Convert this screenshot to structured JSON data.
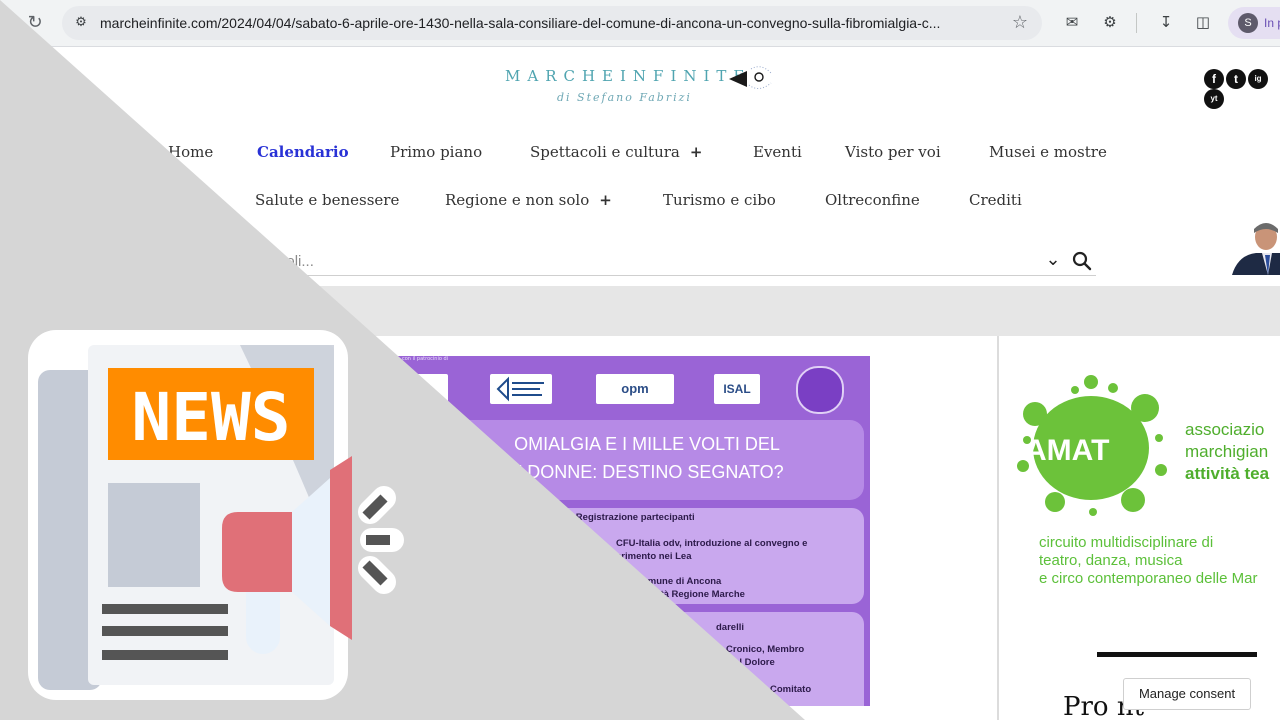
{
  "browser": {
    "url": "marcheinfinite.com/2024/04/04/sabato-6-aprile-ore-1430-nella-sala-consiliare-del-comune-di-ancona-un-convegno-sulla-fibromialgia-c...",
    "profile_initial": "S",
    "profile_text": "In p"
  },
  "site": {
    "logo_main": "MARCHEINFINITE",
    "logo_sub": "di Stefano Fabrizi",
    "social": [
      "f",
      "t",
      "ig",
      "yt"
    ],
    "nav_row1": [
      "Home",
      "Calendario",
      "Primo piano",
      "Spettacoli e cultura",
      "Eventi",
      "Visto per voi",
      "Musei e mostre"
    ],
    "nav_row2": [
      "Salute e benessere",
      "Regione e non solo",
      "Turismo e cibo",
      "Oltreconfine",
      "Crediti"
    ],
    "nav_plus": "+",
    "search_placeholder": "ca articoli..."
  },
  "poster": {
    "top_text": "con il patrocinio di",
    "sponsors": [
      "opm",
      "ISAL"
    ],
    "title_line1": "OMIALGIA E I MILLE VOLTI DEL",
    "title_line2": "E DONNE: DESTINO SEGNATO?",
    "lines": [
      "- Registrazione partecipanti",
      "CFU-Italia odv, introduzione al convegno e",
      "erimento nei Lea",
      "omune di Ancona",
      "nità Regione Marche",
      "darelli",
      "lore Cronico, Membro",
      "gia e del Dolore",
      "dente Comitato"
    ]
  },
  "sidebar": {
    "amat_logo": "AMAT",
    "amat_lines": [
      "associazio",
      "marchigian",
      "attività tea"
    ],
    "desc_lines": [
      "circuito multidisciplinare di",
      "teatro, danza, musica",
      "e circo contemporaneo delle Mar"
    ],
    "bottom_title": "Pro                nt"
  },
  "consent": "Manage consent",
  "overlay": {
    "news_label": "NEWS",
    "colors": {
      "triangle": "#d8d8d8",
      "news_bg": "#ff8c00",
      "megaphone": "#e07078"
    }
  }
}
